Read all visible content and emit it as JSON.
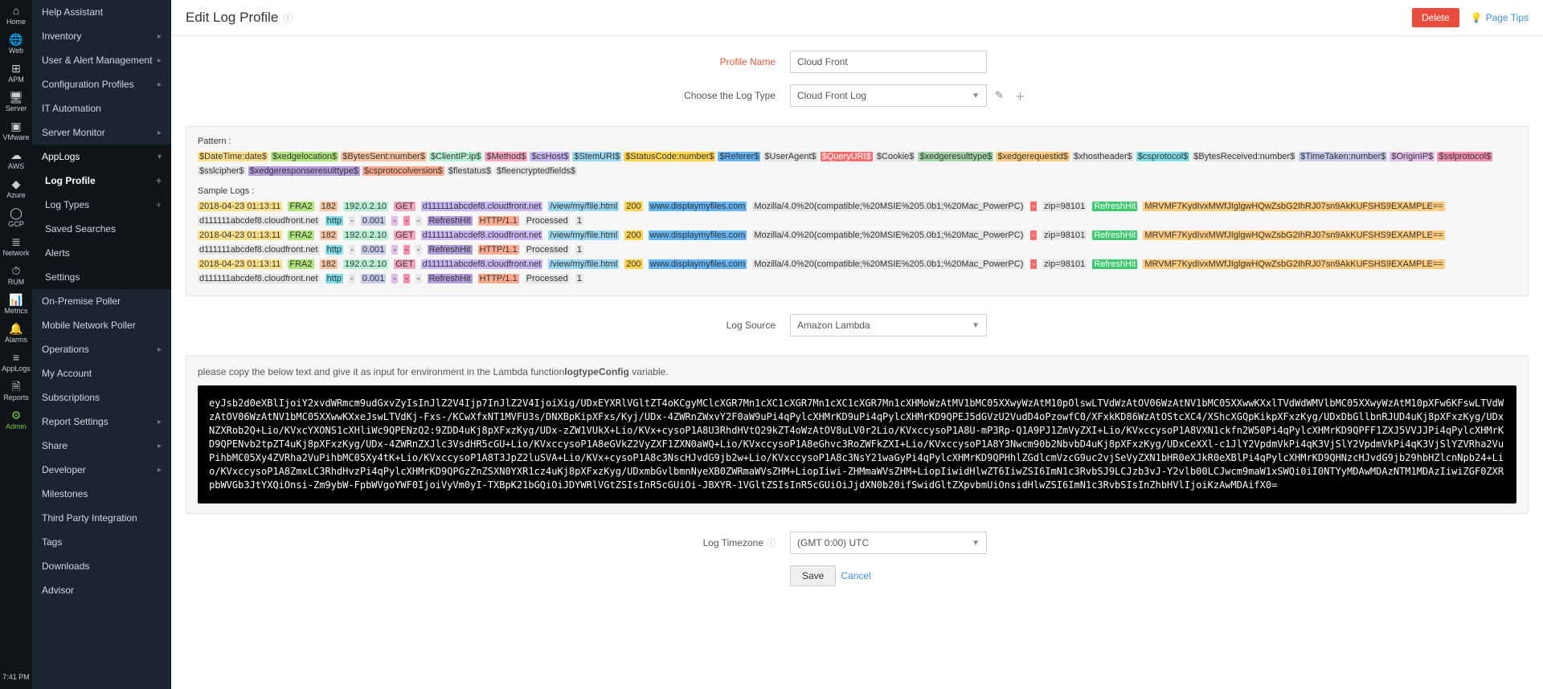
{
  "rail": [
    {
      "label": "Home",
      "icon": "⌂"
    },
    {
      "label": "Web",
      "icon": "🌐"
    },
    {
      "label": "APM",
      "icon": "⊞"
    },
    {
      "label": "Server",
      "icon": "🖥"
    },
    {
      "label": "VMware",
      "icon": "▣"
    },
    {
      "label": "AWS",
      "icon": "☁"
    },
    {
      "label": "Azure",
      "icon": "◆"
    },
    {
      "label": "GCP",
      "icon": "◯"
    },
    {
      "label": "Network",
      "icon": "≣"
    },
    {
      "label": "RUM",
      "icon": "⏱"
    },
    {
      "label": "Metrics",
      "icon": "📊"
    },
    {
      "label": "Alarms",
      "icon": "🔔"
    },
    {
      "label": "AppLogs",
      "icon": "≡"
    },
    {
      "label": "Reports",
      "icon": "🗎"
    },
    {
      "label": "Admin",
      "icon": "⚙",
      "active": true
    }
  ],
  "rail_time": "7:41 PM",
  "nav": {
    "items": [
      {
        "label": "Help Assistant"
      },
      {
        "label": "Inventory",
        "hasChildren": true
      },
      {
        "label": "User & Alert Management",
        "hasChildren": true
      },
      {
        "label": "Configuration Profiles",
        "hasChildren": true
      },
      {
        "label": "IT Automation"
      },
      {
        "label": "Server Monitor",
        "hasChildren": true
      },
      {
        "label": "AppLogs",
        "hasChildren": true,
        "open": true,
        "children": [
          {
            "label": "Log Profile",
            "active": true,
            "plus": true
          },
          {
            "label": "Log Types",
            "plus": true
          },
          {
            "label": "Saved Searches"
          },
          {
            "label": "Alerts"
          },
          {
            "label": "Settings"
          }
        ]
      },
      {
        "label": "On-Premise Poller"
      },
      {
        "label": "Mobile Network Poller"
      },
      {
        "label": "Operations",
        "hasChildren": true
      },
      {
        "label": "My Account"
      },
      {
        "label": "Subscriptions"
      },
      {
        "label": "Report Settings",
        "hasChildren": true
      },
      {
        "label": "Share",
        "hasChildren": true
      },
      {
        "label": "Developer",
        "hasChildren": true
      },
      {
        "label": "Milestones"
      },
      {
        "label": "Third Party Integration"
      },
      {
        "label": "Tags"
      },
      {
        "label": "Downloads"
      },
      {
        "label": "Advisor"
      }
    ]
  },
  "header": {
    "title": "Edit Log Profile",
    "delete": "Delete",
    "page_tips": "Page Tips"
  },
  "form": {
    "profile_name_label": "Profile Name",
    "profile_name_value": "Cloud Front",
    "log_type_label": "Choose the Log Type",
    "log_type_value": "Cloud Front Log",
    "log_source_label": "Log Source",
    "log_source_value": "Amazon Lambda",
    "timezone_label": "Log Timezone",
    "timezone_value": "(GMT 0:00) UTC",
    "save": "Save",
    "cancel": "Cancel"
  },
  "pattern": {
    "title": "Pattern :",
    "tokens": [
      {
        "t": "$DateTime:date$",
        "c": "c1"
      },
      {
        "t": "$xedgelocation$",
        "c": "c2"
      },
      {
        "t": "$BytesSent:number$",
        "c": "c3"
      },
      {
        "t": "$ClientIP:ip$",
        "c": "c4"
      },
      {
        "t": "$Method$",
        "c": "c5"
      },
      {
        "t": "$csHost$",
        "c": "c6"
      },
      {
        "t": "$StemURI$",
        "c": "c7"
      },
      {
        "t": "$StatusCode:number$",
        "c": "c11"
      },
      {
        "t": "$Referer$",
        "c": "c10"
      },
      {
        "t": "$UserAgent$",
        "c": "c13"
      },
      {
        "t": "$QueryURI$",
        "c": "c8"
      },
      {
        "t": "$Cookie$",
        "c": "c13"
      },
      {
        "t": "$xedgeresulttype$",
        "c": "c17"
      },
      {
        "t": "$xedgerequestid$",
        "c": "c16"
      },
      {
        "t": "$xhostheader$",
        "c": "c13"
      },
      {
        "t": "$csprotocol$",
        "c": "c15"
      },
      {
        "t": "$BytesReceived:number$",
        "c": "c13"
      },
      {
        "t": "$TimeTaken:number$",
        "c": "c14"
      },
      {
        "t": "$OriginIP$",
        "c": "c18"
      },
      {
        "t": "$sslprotocol$",
        "c": "c12"
      },
      {
        "t": "$sslcipher$",
        "c": "c13"
      },
      {
        "t": "$xedgeresponseresulttype$",
        "c": "c20"
      },
      {
        "t": "$csprotocolversion$",
        "c": "c19"
      },
      {
        "t": "$flestatus$",
        "c": "c13"
      },
      {
        "t": "$fleencryptedfields$",
        "c": "c13"
      }
    ]
  },
  "sample": {
    "title": "Sample Logs :",
    "rows": [
      [
        {
          "t": "2018-04-23 01:13:11",
          "c": "c1"
        },
        {
          "t": " ",
          "c": "plain"
        },
        {
          "t": "FRA2",
          "c": "c2"
        },
        {
          "t": " ",
          "c": "plain"
        },
        {
          "t": "182",
          "c": "c3"
        },
        {
          "t": " ",
          "c": "plain"
        },
        {
          "t": "192.0.2.10",
          "c": "c4"
        },
        {
          "t": " ",
          "c": "plain"
        },
        {
          "t": "GET",
          "c": "c5"
        },
        {
          "t": " ",
          "c": "plain"
        },
        {
          "t": "d111111abcdef8.cloudfront.net",
          "c": "c6"
        },
        {
          "t": " ",
          "c": "plain"
        },
        {
          "t": "/view/my/file.html",
          "c": "c7"
        },
        {
          "t": " ",
          "c": "plain"
        },
        {
          "t": "200",
          "c": "c11"
        },
        {
          "t": " ",
          "c": "plain"
        },
        {
          "t": "www.displaymyfiles.com",
          "c": "c10"
        },
        {
          "t": " ",
          "c": "plain"
        },
        {
          "t": "Mozilla/4.0%20(compatible;%20MSIE%205.0b1;%20Mac_PowerPC)",
          "c": "c13"
        },
        {
          "t": " ",
          "c": "plain"
        },
        {
          "t": "-",
          "c": "c8"
        },
        {
          "t": " ",
          "c": "plain"
        },
        {
          "t": "zip=98101",
          "c": "c13"
        },
        {
          "t": " ",
          "c": "plain"
        },
        {
          "t": "RefreshHit",
          "c": "c9"
        },
        {
          "t": " ",
          "c": "plain"
        },
        {
          "t": "MRVMF7KydIvxMWfJIglgwHQwZsbG2IhRJ07sn9AkKUFSHS9EXAMPLE==",
          "c": "c16"
        },
        {
          "t": " ",
          "c": "plain"
        },
        {
          "t": "d111111abcdef8.cloudfront.net",
          "c": "c13"
        },
        {
          "t": " ",
          "c": "plain"
        },
        {
          "t": "http",
          "c": "c15"
        },
        {
          "t": " ",
          "c": "plain"
        },
        {
          "t": "-",
          "c": "c13"
        },
        {
          "t": " ",
          "c": "plain"
        },
        {
          "t": "0.001",
          "c": "c14"
        },
        {
          "t": " ",
          "c": "plain"
        },
        {
          "t": "-",
          "c": "c18"
        },
        {
          "t": " ",
          "c": "plain"
        },
        {
          "t": "-",
          "c": "c12"
        },
        {
          "t": " ",
          "c": "plain"
        },
        {
          "t": "-",
          "c": "c13"
        },
        {
          "t": " ",
          "c": "plain"
        },
        {
          "t": "RefreshHit",
          "c": "c20"
        },
        {
          "t": " ",
          "c": "plain"
        },
        {
          "t": "HTTP/1.1",
          "c": "c19"
        },
        {
          "t": " ",
          "c": "plain"
        },
        {
          "t": "Processed",
          "c": "c13"
        },
        {
          "t": " ",
          "c": "plain"
        },
        {
          "t": "1",
          "c": "c13"
        }
      ]
    ],
    "repeat": 3
  },
  "lambda": {
    "note_prefix": "please copy the below text and give it as input for environment in the Lambda function",
    "note_bold": "logtypeConfig",
    "note_suffix": " variable.",
    "code": "eyJsb2d0eXBlIjoiY2xvdWRmcm9udGxvZyIsInJlZ2V4Ijp7InJlZ2V4IjoiXig/UDxEYXRlVGltZT4oKCgyMClcXGR7Mn1cXC1cXGR7Mn1cXC1cXGR7Mn1cXHMoWzAtMV1bMC05XXwyWzAtM10pOlswLTVdWzAtOV06WzAtNV1bMC05XXwwKXxlTVdWdWMVlbMC05XXwyWzAtM10pXFw6KFswLTVdWzAtOV06WzAtNV1bMC05XXwwKXxeJswLTVdKj-Fxs-/KCwXfxNT1MVFU3s/DNXBpKipXFxs/Kyj/UDx-4ZWRnZWxvY2F0aW9uPi4qPylcXHMrKD9uPi4qPylcXHMrKD9QPEJ5dGVzU2VudD4oPzowfC0/XFxkKD86WzAtOStcXC4/XShcXGQpKikpXFxzKyg/UDxDbGllbnRJUD4uKj8pXFxzKyg/UDxNZXRob2Q+Lio/KVxcYXONS1cXHliWc9QPENzQ2:9ZDD4uKj8pXFxzKyg/UDx-zZW1VUkX+Lio/KVx+cysoP1A8U3RhdHVtQ29kZT4oWzAtOV8uLV0r2Lio/KVxccysoP1A8U-mP3Rp-Q1A9PJ1ZmVyZXI+Lio/KVxccysoP1A8VXN1ckfn2W50Pi4qPylcXHMrKD9QPFF1ZXJ5VVJJPi4qPylcXHMrKD9QPENvb2tpZT4uKj8pXFxzKyg/UDx-4ZWRnZXJlc3VsdHR5cGU+Lio/KVxccysoP1A8eGVkZ2VyZXF1ZXN0aWQ+Lio/KVxccysoP1A8eGhvc3RoZWFkZXI+Lio/KVxccysoP1A8Y3Nwcm90b2NbvbD4uKj8pXFxzKyg/UDxCeXXl-c1JlY2VpdmVkPi4qK3VjSlY2VpdmVkPi4qK3VjSlYZVRha2VuPihbMC05Xy4ZVRha2VuPihbMC05Xy4tK+Lio/KVxccysoP1A8T3JpZ2luSVA+Lio/KVx+cysoP1A8c3NscHJvdG9jb2w+Lio/KVxccysoP1A8c3NsY21waGyPi4qPylcXHMrKD9QPHhlZGdlcmVzcG9uc2vjSeVyZXN1bHR0eXJkR0eXBlPi4qPylcXHMrKD9QHNzcHJvdG9jb29hbHZlcnNpb24+Lio/KVxccysoP1A8ZmxLC3RhdHvzPi4qPylcXHMrKD9QPGzZnZSXN0YXR1cz4uKj8pXFxzKyg/UDxmbGvlbmnNyeXB0ZWRmaWVsZHM+LiopIiwi-ZHMmaWVsZHM+LiopIiwidHlwZT6IiwZSI6ImN1c3RvbSJ9LCJzb3vJ-Y2vlb00LCJwcm9maW1xSWQi0iI0NTYyMDAwMDAzNTM1MDAzIiwiZGF0ZXRpbWVGb3JtYXQiOnsi-Zm9ybW-FpbWVgoYWF0IjoiVyVm0yI-TXBpK21bGQiOiJDYWRlVGtZSIsInR5cGUiOi-JBXYR-1VGltZSIsInR5cGUiOiJjdXN0b20ifSwidGltZXpvbmUiOnsidHlwZSI6ImN1c3RvbSIsInZhbHVlIjoiKzAwMDAifX0="
  }
}
